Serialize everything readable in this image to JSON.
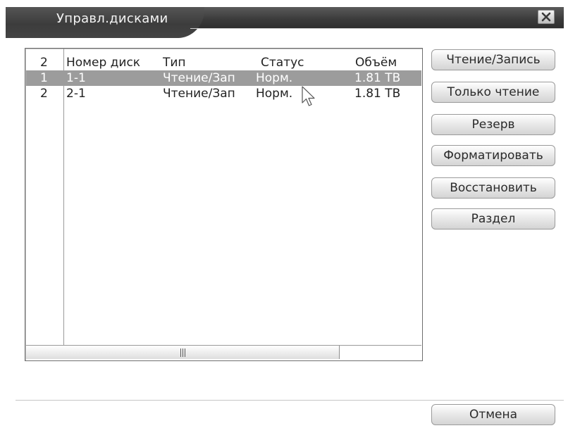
{
  "window": {
    "title": "Управл.дисками",
    "close_icon": "close-icon"
  },
  "table": {
    "headers": [
      "2",
      "Номер диск",
      "Тип",
      "Статус",
      "Объём"
    ],
    "rows": [
      {
        "index": "1",
        "disk": "1-1",
        "type": "Чтение/Зап",
        "status": "Норм.",
        "size": "1.81 TB",
        "selected": true
      },
      {
        "index": "2",
        "disk": "2-1",
        "type": "Чтение/Зап",
        "status": "Норм.",
        "size": "1.81 TB",
        "selected": false
      }
    ]
  },
  "buttons": {
    "read_write": "Чтение/Запись",
    "read_only": "Только чтение",
    "reserve": "Резерв",
    "format": "Форматировать",
    "restore": "Восстановить",
    "partition": "Раздел",
    "cancel": "Отмена"
  },
  "colors": {
    "title_bar": "#3c3c3c",
    "selected_row": "#9c9c9c"
  }
}
